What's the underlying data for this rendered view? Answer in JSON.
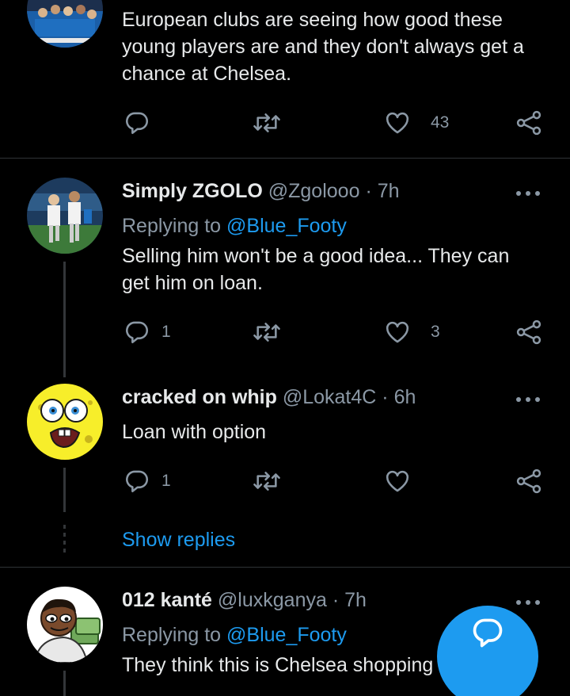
{
  "tweets": [
    {
      "text": "European clubs are seeing how good these young players are and they don't always get a chance at Chelsea.",
      "actions": {
        "reply_count": "",
        "retweet_count": "",
        "like_count": "43"
      }
    },
    {
      "name": "Simply ZGOLO",
      "handle": "@Zgolooo",
      "time": "· 7h",
      "replying_prefix": "Replying to",
      "replying_to": "@Blue_Footy",
      "text": "Selling him won't be a good idea... They can get him on loan.",
      "actions": {
        "reply_count": "1",
        "retweet_count": "",
        "like_count": "3"
      }
    },
    {
      "name": "cracked on whip",
      "handle": "@Lokat4C",
      "time": "· 6h",
      "text": "Loan with option",
      "actions": {
        "reply_count": "1",
        "retweet_count": "",
        "like_count": ""
      }
    },
    {
      "name": "012 kanté",
      "handle": "@luxkganya",
      "time": "· 7h",
      "replying_prefix": "Replying to",
      "replying_to": "@Blue_Footy",
      "text": "They think this is Chelsea shopping"
    }
  ],
  "show_replies_label": "Show replies",
  "icons": {
    "reply": "reply-icon",
    "retweet": "retweet-icon",
    "like": "heart-icon",
    "share": "share-icon",
    "more": "more-icon",
    "compose": "compose-reply-icon"
  },
  "colors": {
    "background": "#000000",
    "text": "#e7e9ea",
    "secondary": "#8b98a5",
    "accent": "#1d9bf0",
    "divider": "#2f3336"
  }
}
